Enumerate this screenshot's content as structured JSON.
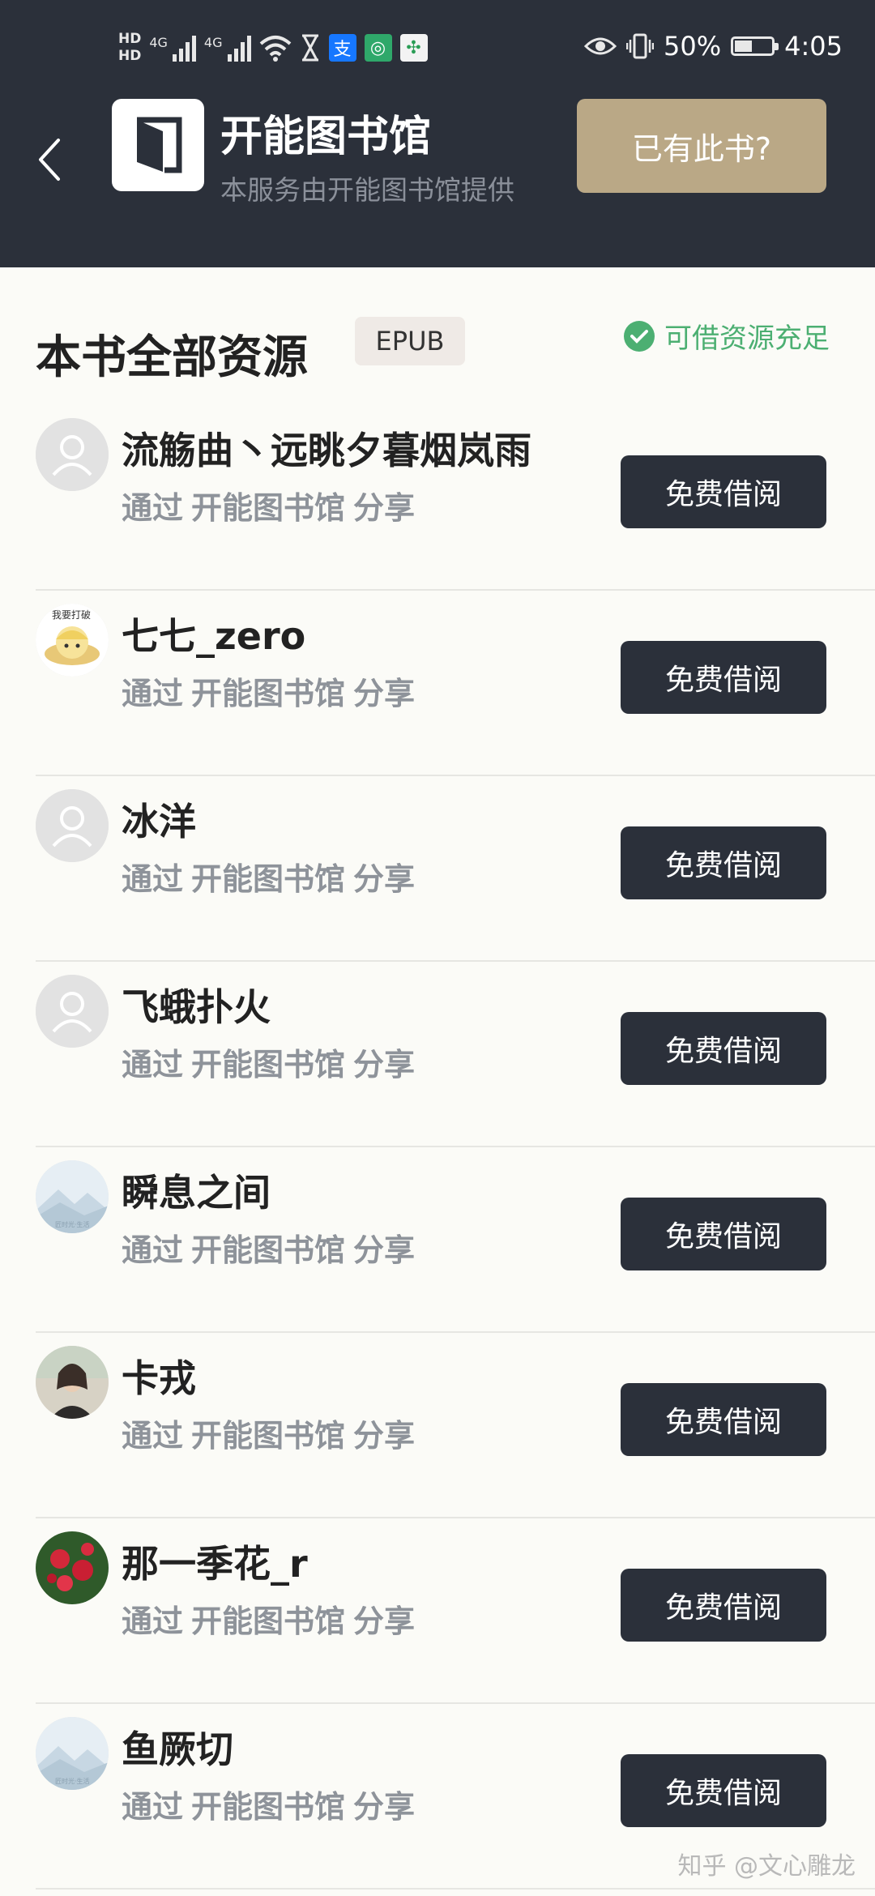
{
  "status_bar": {
    "hd1": "HD",
    "hd2": "HD",
    "net1": "4G",
    "net2": "4G",
    "battery": "50%",
    "battery_level": 0.5,
    "time": "4:05",
    "icons": [
      "signal-icon",
      "wifi-icon",
      "hourglass-icon",
      "alipay-icon",
      "app-icon",
      "china-mobile-icon",
      "eye-icon",
      "vibrate-icon",
      "battery-icon"
    ]
  },
  "header": {
    "library_name": "开能图书馆",
    "library_subtitle": "本服务由开能图书馆提供",
    "have_book_button": "已有此书?"
  },
  "section": {
    "title": "本书全部资源",
    "format": "EPUB",
    "availability": "可借资源充足"
  },
  "resources": [
    {
      "user": "流觞曲丶远眺夕暮烟岚雨",
      "via": "通过",
      "library": "开能图书馆",
      "action": "分享",
      "button": "免费借阅",
      "avatar": "default"
    },
    {
      "user": "七七_zero",
      "via": "通过",
      "library": "开能图书馆",
      "action": "分享",
      "button": "免费借阅",
      "avatar": "cartoon"
    },
    {
      "user": "冰洋",
      "via": "通过",
      "library": "开能图书馆",
      "action": "分享",
      "button": "免费借阅",
      "avatar": "default"
    },
    {
      "user": "飞蛾扑火",
      "via": "通过",
      "library": "开能图书馆",
      "action": "分享",
      "button": "免费借阅",
      "avatar": "default"
    },
    {
      "user": "瞬息之间",
      "via": "通过",
      "library": "开能图书馆",
      "action": "分享",
      "button": "免费借阅",
      "avatar": "landscape"
    },
    {
      "user": "卡戎",
      "via": "通过",
      "library": "开能图书馆",
      "action": "分享",
      "button": "免费借阅",
      "avatar": "photo"
    },
    {
      "user": "那一季花_r",
      "via": "通过",
      "library": "开能图书馆",
      "action": "分享",
      "button": "免费借阅",
      "avatar": "flower"
    },
    {
      "user": "鱼厥切",
      "via": "通过",
      "library": "开能图书馆",
      "action": "分享",
      "button": "免费借阅",
      "avatar": "landscape"
    }
  ],
  "watermark": "知乎 @文心雕龙",
  "colors": {
    "header_bg": "#2b303a",
    "gold_button": "#baa886",
    "dark_button": "#2b303a",
    "available_green": "#4caf72",
    "muted_text": "#8e939a"
  }
}
